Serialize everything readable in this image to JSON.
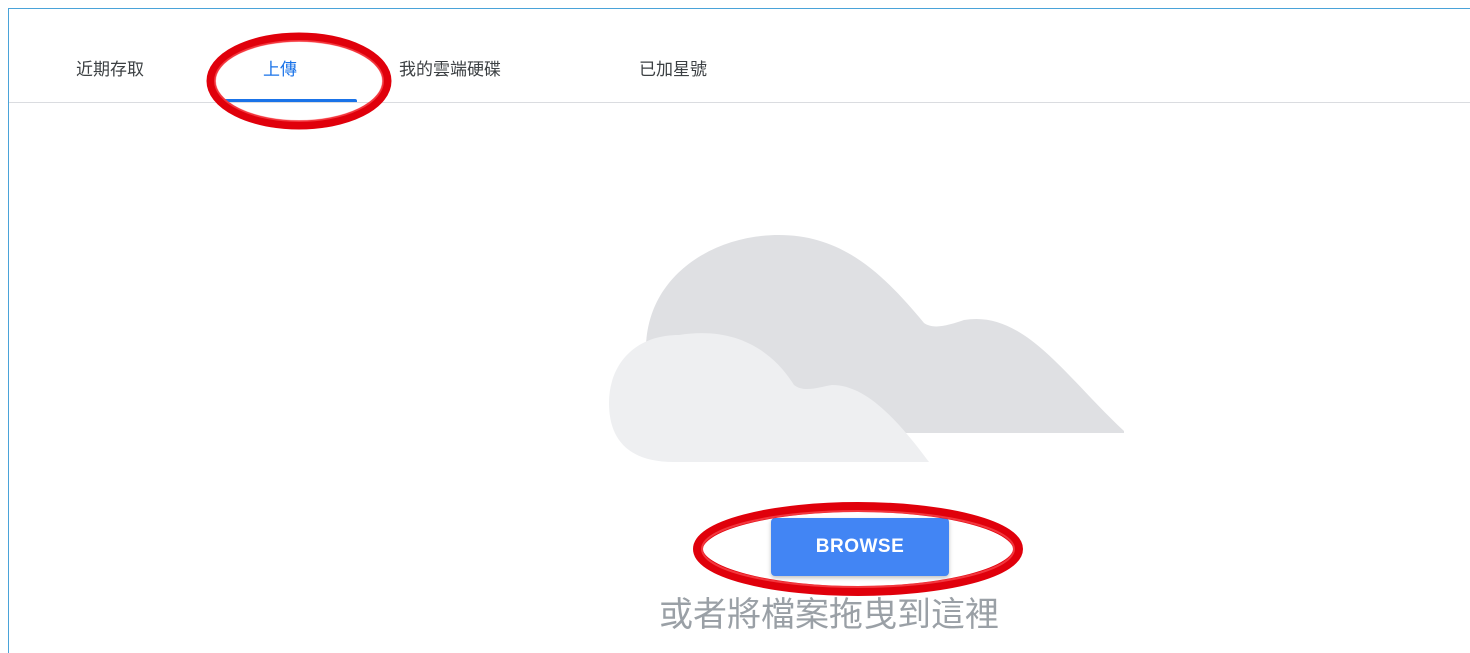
{
  "tabs": [
    {
      "label": "近期存取",
      "active": false
    },
    {
      "label": "上傳",
      "active": true
    },
    {
      "label": "我的雲端硬碟",
      "active": false
    },
    {
      "label": "已加星號",
      "active": false
    }
  ],
  "upload": {
    "illustration_icon": "cloud-icon",
    "browse_label": "BROWSE",
    "drop_hint": "或者將檔案拖曳到這裡"
  },
  "colors": {
    "accent": "#1a73e8",
    "button": "#4285f4",
    "annotation": "#e0000b",
    "cloud_back": "#dfe0e3",
    "cloud_front": "#eeeff1"
  }
}
